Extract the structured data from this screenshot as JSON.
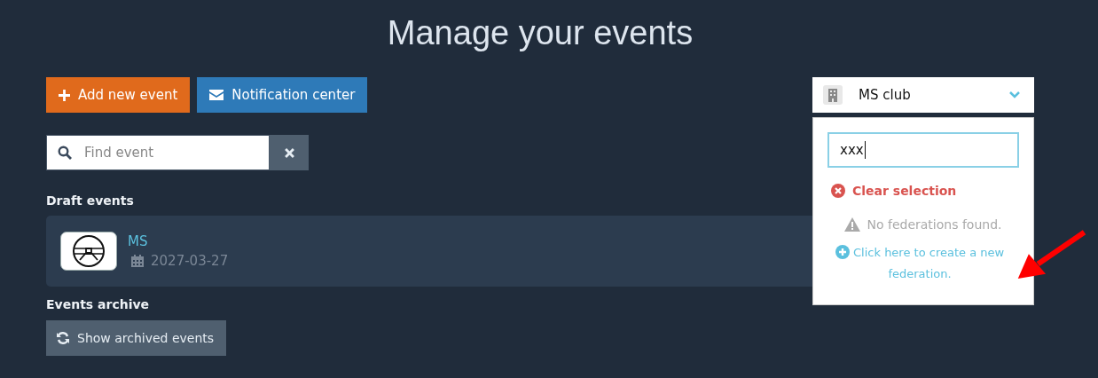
{
  "title": "Manage your events",
  "actions": [
    {
      "kind": "add",
      "label": "Add new event"
    },
    {
      "kind": "notify",
      "label": "Notification center"
    }
  ],
  "search": {
    "placeholder": "Find event"
  },
  "club_select": {
    "value": "MS club",
    "dropdown": {
      "query": "xxx",
      "clear_label": "Clear selection",
      "empty_message": "No federations found.",
      "create_link": "Click here to create a new federation."
    }
  },
  "draft_section": {
    "heading": "Draft events",
    "events": [
      {
        "name": "MS",
        "date": "2027-03-27"
      }
    ]
  },
  "archive_section": {
    "heading": "Events archive",
    "button": "Show archived events"
  },
  "annotation": {
    "kind": "arrow"
  }
}
